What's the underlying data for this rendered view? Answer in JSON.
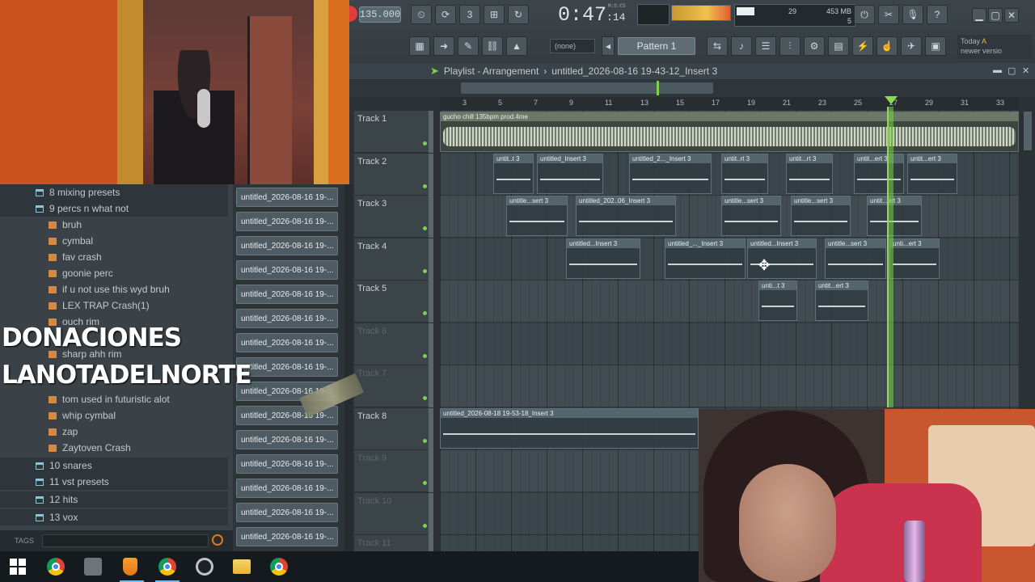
{
  "toolbar": {
    "tempo": "135.000",
    "time_main": "0:47",
    "time_small": ":14",
    "time_label": "M:S:CS",
    "cpu_value": "29",
    "ram_value": "453 MB",
    "poly_value": "5",
    "snap_label": "(none)",
    "pattern_label": "Pattern 1",
    "news_line1": "Today",
    "news_line2": "newer versio",
    "news_flag": "A",
    "help_label": "?"
  },
  "playlist": {
    "title": "Playlist - Arrangement",
    "project": "untitled_2026-08-16 19-43-12_Insert 3",
    "ruler": [
      "3",
      "5",
      "7",
      "9",
      "11",
      "13",
      "15",
      "17",
      "19",
      "21",
      "23",
      "25",
      "27",
      "29",
      "31",
      "33"
    ],
    "tracks": [
      "Track 1",
      "Track 2",
      "Track 3",
      "Track 4",
      "Track 5",
      "Track 6",
      "Track 7",
      "Track 8",
      "Track 9",
      "Track 10",
      "Track 11"
    ],
    "clips": {
      "big": "gucho chill 135bpm prod.4me",
      "c2a": "untit..t 3",
      "c2b": "untitled_Insert 3",
      "c2c": "untitled_2..._Insert 3",
      "c2d": "untit..rt 3",
      "c2e": "untit...rt 3",
      "c2f": "untit...ert 3",
      "c2g": "untit...ert 3",
      "c3a": "untitle...sert 3",
      "c3b": "untitled_202..06_Insert 3",
      "c3c": "untitle...sert 3",
      "c3d": "untitle...sert 3",
      "c3e": "untit...ert 3",
      "c4a": "untitled...Insert 3",
      "c4b": "untitled_..._Insert 3",
      "c4c": "untitled...Insert 3",
      "c4d": "untitle...sert 3",
      "c4e": "unti...ert 3",
      "c5a": "unti...t 3",
      "c5b": "untit...ert 3",
      "c8a": "untitled_2026-08-18 19-53-18_Insert 3"
    }
  },
  "browser": {
    "items": [
      {
        "label": "8 mixing presets",
        "kind": "folder",
        "indent": 1
      },
      {
        "label": "9 percs n what not",
        "kind": "folder",
        "indent": 1
      },
      {
        "label": "bruh",
        "kind": "file",
        "indent": 2
      },
      {
        "label": "cymbal",
        "kind": "file",
        "indent": 2
      },
      {
        "label": "fav crash",
        "kind": "file",
        "indent": 2
      },
      {
        "label": "goonie perc",
        "kind": "file",
        "indent": 2
      },
      {
        "label": "if u not use this wyd bruh",
        "kind": "file",
        "indent": 2
      },
      {
        "label": "LEX TRAP Crash(1)",
        "kind": "file",
        "indent": 2
      },
      {
        "label": "ouch rim",
        "kind": "file",
        "indent": 2
      },
      {
        "label": "sharp ahh rim",
        "kind": "file",
        "indent": 2
      },
      {
        "label": "tom used in futuristic alot",
        "kind": "file",
        "indent": 2
      },
      {
        "label": "whip cymbal",
        "kind": "file",
        "indent": 2
      },
      {
        "label": "zap",
        "kind": "file",
        "indent": 2
      },
      {
        "label": "Zaytoven Crash",
        "kind": "file",
        "indent": 2
      },
      {
        "label": "10 snares",
        "kind": "folder",
        "indent": 1
      },
      {
        "label": "11 vst presets",
        "kind": "folder",
        "indent": 1
      },
      {
        "label": "12 hits",
        "kind": "folder",
        "indent": 1
      },
      {
        "label": "13 vox",
        "kind": "folder",
        "indent": 1
      }
    ],
    "tags_label": "TAGS"
  },
  "files": {
    "label": "untitled_2026-08-16 19-..."
  },
  "overlay": {
    "line1": "DONACIONES",
    "line2": "LANOTADELNORTE"
  }
}
